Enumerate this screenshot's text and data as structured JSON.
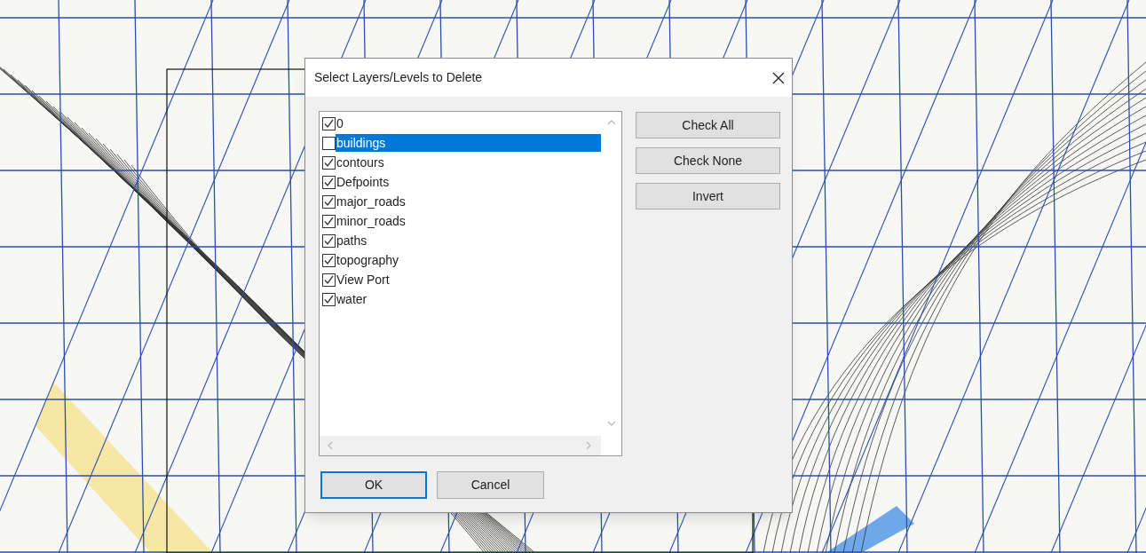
{
  "dialog": {
    "title": "Select Layers/Levels to Delete",
    "layers": [
      {
        "label": "0",
        "checked": true,
        "selected": false
      },
      {
        "label": "buildings",
        "checked": false,
        "selected": true
      },
      {
        "label": "contours",
        "checked": true,
        "selected": false
      },
      {
        "label": "Defpoints",
        "checked": true,
        "selected": false
      },
      {
        "label": "major_roads",
        "checked": true,
        "selected": false
      },
      {
        "label": "minor_roads",
        "checked": true,
        "selected": false
      },
      {
        "label": "paths",
        "checked": true,
        "selected": false
      },
      {
        "label": "topography",
        "checked": true,
        "selected": false
      },
      {
        "label": "View Port",
        "checked": true,
        "selected": false
      },
      {
        "label": "water",
        "checked": true,
        "selected": false
      }
    ],
    "side_buttons": [
      "Check All",
      "Check None",
      "Invert"
    ],
    "ok": "OK",
    "cancel": "Cancel"
  }
}
